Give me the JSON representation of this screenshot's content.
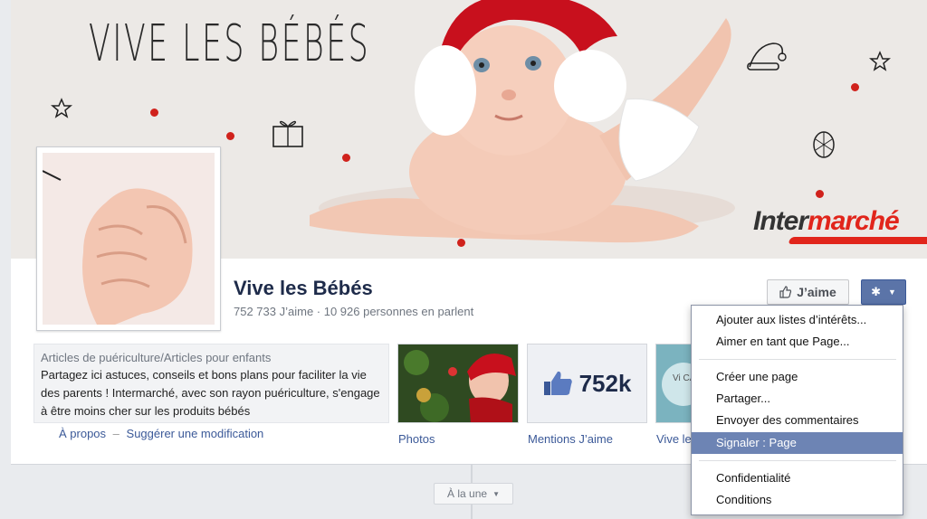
{
  "cover": {
    "title": "VIVE LES BÉBÉS",
    "brand_part1": "Inter",
    "brand_part2": "marché"
  },
  "page": {
    "name": "Vive les Bébés",
    "stats": "752 733 J’aime · 10 926 personnes en parlent"
  },
  "actions": {
    "like_label": "J’aime",
    "gear_icon": "gear-icon"
  },
  "about": {
    "category": "Articles de puériculture/Articles pour enfants",
    "description": "Partagez ici astuces, conseils et bons plans pour faciliter la vie des parents ! Intermarché, avec son rayon puériculture, s'engage à être moins cher sur les produits bébés",
    "link_about": "À propos",
    "link_separator": "–",
    "link_suggest": "Suggérer une modification"
  },
  "tiles": {
    "photos_label": "Photos",
    "likes_count": "752k",
    "likes_label": "Mentions J’aime",
    "vive_label": "Vive le",
    "vive_thumb_text": "Vi CA"
  },
  "menu": {
    "items": [
      "Ajouter aux listes d’intérêts...",
      "Aimer en tant que Page...",
      "Créer une page",
      "Partager...",
      "Envoyer des commentaires",
      "Signaler : Page",
      "Confidentialité",
      "Conditions"
    ],
    "active_item": "Signaler : Page"
  },
  "timeline": {
    "a_la_une_label": "À la une"
  },
  "colors": {
    "facebook_blue": "#3b5998",
    "menu_highlight": "#6d84b4",
    "brand_red": "#e1251b"
  }
}
